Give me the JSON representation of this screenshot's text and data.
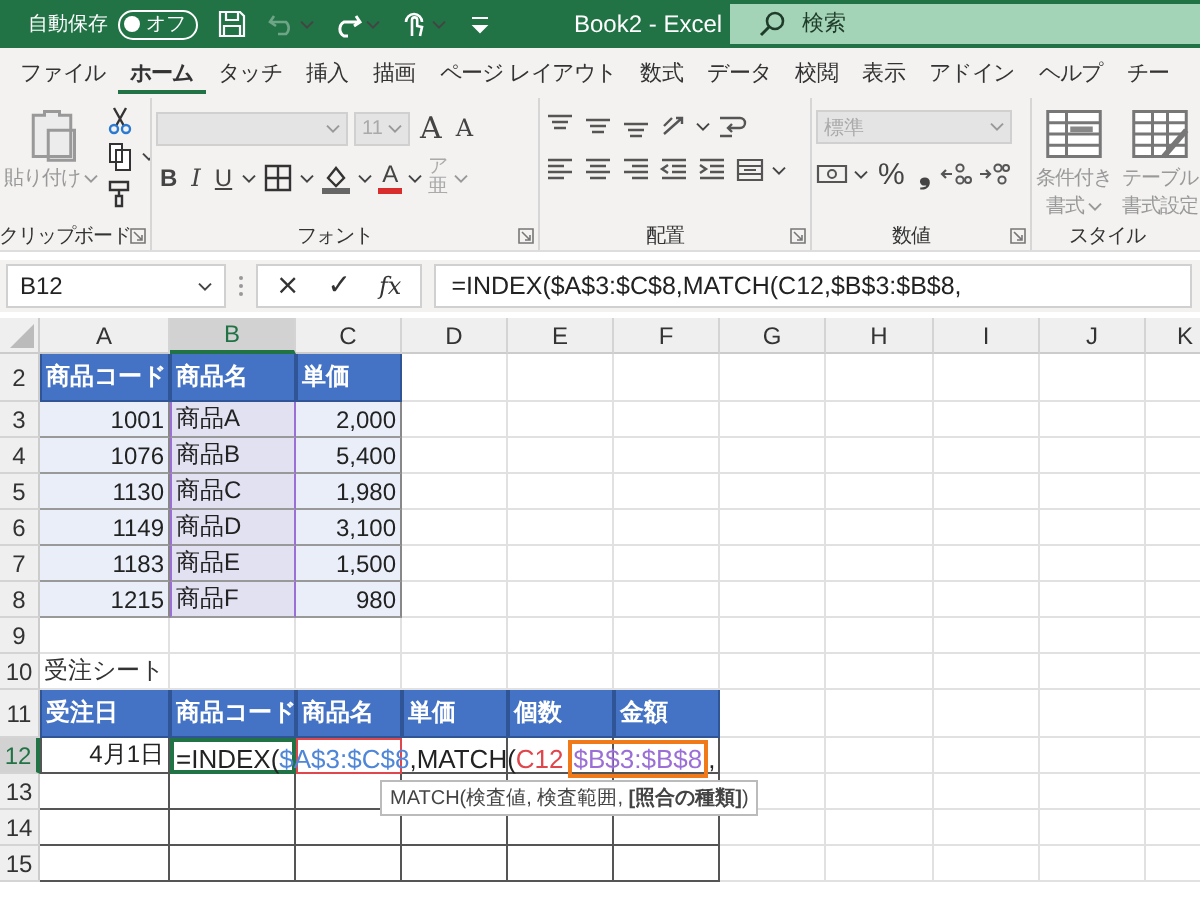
{
  "titlebar": {
    "autosave_label": "自動保存",
    "autosave": {
      "on": false,
      "label": "オフ"
    },
    "quick_access": [
      {
        "kind": "save",
        "disabled": false,
        "menu": false
      },
      {
        "kind": "undo",
        "disabled": true,
        "menu": true
      },
      {
        "kind": "redo",
        "disabled": false,
        "menu": true
      },
      {
        "kind": "touch",
        "disabled": false,
        "menu": true
      },
      {
        "kind": "customize",
        "disabled": false,
        "menu": false
      }
    ],
    "title": "Book2  -  Excel",
    "search": {
      "placeholder": "検索"
    }
  },
  "tabs": [
    {
      "label": "ファイル",
      "selected": false
    },
    {
      "label": "ホーム",
      "selected": true
    },
    {
      "label": "タッチ",
      "selected": false
    },
    {
      "label": "挿入",
      "selected": false
    },
    {
      "label": "描画",
      "selected": false
    },
    {
      "label": "ページ レイアウト",
      "selected": false
    },
    {
      "label": "数式",
      "selected": false
    },
    {
      "label": "データ",
      "selected": false
    },
    {
      "label": "校閲",
      "selected": false
    },
    {
      "label": "表示",
      "selected": false
    },
    {
      "label": "アドイン",
      "selected": false
    },
    {
      "label": "ヘルプ",
      "selected": false
    },
    {
      "label": "チー",
      "selected": false
    }
  ],
  "ribbon": [
    {
      "label": "クリップボード",
      "launcher": true,
      "large": [
        {
          "kind": "paste",
          "lines": [
            "貼り付け"
          ],
          "disabled": true,
          "menu": true
        }
      ],
      "rows": [
        {
          "items": [
            {
              "kind": "cut",
              "disabled": false,
              "menu": false
            }
          ]
        },
        {
          "items": [
            {
              "kind": "copy",
              "disabled": false,
              "menu": true
            }
          ]
        },
        {
          "items": [
            {
              "kind": "painter",
              "disabled": false,
              "menu": false
            }
          ]
        }
      ]
    },
    {
      "label": "フォント",
      "launcher": true,
      "rows": [
        {
          "items": [
            {
              "kind": "fontbox",
              "disabled": true,
              "menu": true
            },
            {
              "kind": "sizebox",
              "text": "11",
              "disabled": true,
              "menu": true
            },
            {
              "kind": "grow",
              "text": "A",
              "disabled": false,
              "menu": false
            },
            {
              "kind": "shrink",
              "text": "A",
              "disabled": false,
              "menu": false
            }
          ]
        },
        {
          "items": [
            {
              "kind": "bold",
              "text": "B",
              "disabled": false,
              "menu": false
            },
            {
              "kind": "italic",
              "text": "I",
              "disabled": false,
              "menu": false
            },
            {
              "kind": "underline",
              "text": "U",
              "disabled": false,
              "menu": true
            },
            {
              "kind": "borders",
              "disabled": false,
              "menu": true
            },
            {
              "kind": "fill",
              "disabled": false,
              "menu": true
            },
            {
              "kind": "fontcolor",
              "text": "A",
              "disabled": false,
              "menu": true
            },
            {
              "kind": "phonetic",
              "text": "ア亜",
              "disabled": true,
              "menu": true
            }
          ]
        }
      ]
    },
    {
      "label": "配置",
      "launcher": true,
      "rows": [
        {
          "items": [
            {
              "kind": "top",
              "disabled": false,
              "menu": false
            },
            {
              "kind": "middle",
              "disabled": false,
              "menu": false
            },
            {
              "kind": "bottom",
              "disabled": false,
              "menu": false
            },
            {
              "kind": "orient",
              "disabled": false,
              "menu": true
            },
            {
              "kind": "wrap",
              "disabled": false,
              "menu": false
            }
          ]
        },
        {
          "items": [
            {
              "kind": "left",
              "disabled": false,
              "menu": false
            },
            {
              "kind": "center",
              "disabled": false,
              "menu": false
            },
            {
              "kind": "right",
              "disabled": false,
              "menu": false
            },
            {
              "kind": "outdent",
              "disabled": false,
              "menu": false
            },
            {
              "kind": "indent",
              "disabled": false,
              "menu": false
            },
            {
              "kind": "merge",
              "disabled": false,
              "menu": true
            }
          ]
        }
      ]
    },
    {
      "label": "数値",
      "launcher": true,
      "rows": [
        {
          "items": [
            {
              "kind": "numbox",
              "text": "標準",
              "disabled": true,
              "menu": true
            }
          ]
        },
        {
          "items": [
            {
              "kind": "accounting",
              "disabled": false,
              "menu": true
            },
            {
              "kind": "percent",
              "text": "%",
              "disabled": false,
              "menu": false
            },
            {
              "kind": "comma",
              "text": "❟",
              "disabled": false,
              "menu": false
            },
            {
              "kind": "incdec",
              "disabled": false,
              "menu": false
            },
            {
              "kind": "decdec",
              "disabled": false,
              "menu": false
            }
          ]
        }
      ]
    },
    {
      "label": "スタイル",
      "launcher": false,
      "large": [
        {
          "kind": "cond",
          "lines": [
            "条件付き",
            "書式"
          ],
          "disabled": true,
          "menu": true
        },
        {
          "kind": "table",
          "lines": [
            "テーブル",
            "書式設定"
          ],
          "disabled": true,
          "menu": false
        }
      ]
    }
  ],
  "formula_bar": {
    "name_box": "B12",
    "cancel": "×",
    "enter": "✓",
    "function": "fx",
    "formula": "=INDEX($A$3:$C$8,MATCH(C12,$B$3:$B$8,"
  },
  "sheet": {
    "columns": [
      {
        "label": "A",
        "selected": false
      },
      {
        "label": "B",
        "selected": true
      },
      {
        "label": "C",
        "selected": false
      },
      {
        "label": "D",
        "selected": false
      },
      {
        "label": "E",
        "selected": false
      },
      {
        "label": "F",
        "selected": false
      },
      {
        "label": "G",
        "selected": false
      },
      {
        "label": "H",
        "selected": false
      },
      {
        "label": "I",
        "selected": false
      },
      {
        "label": "J",
        "selected": false
      },
      {
        "label": "K",
        "selected": false
      }
    ],
    "rows": [
      {
        "number": "2",
        "selected": false,
        "cells": [
          {
            "kind": "head",
            "text": "商品コード"
          },
          {
            "kind": "head",
            "text": "商品名"
          },
          {
            "kind": "head",
            "text": "単価"
          }
        ]
      },
      {
        "number": "3",
        "selected": false,
        "cells": [
          {
            "kind": "num",
            "text": "1001"
          },
          {
            "kind": "item",
            "text": "商品A"
          },
          {
            "kind": "num",
            "text": "2,000"
          }
        ]
      },
      {
        "number": "4",
        "selected": false,
        "cells": [
          {
            "kind": "num",
            "text": "1076"
          },
          {
            "kind": "item",
            "text": "商品B"
          },
          {
            "kind": "num",
            "text": "5,400"
          }
        ]
      },
      {
        "number": "5",
        "selected": false,
        "cells": [
          {
            "kind": "num",
            "text": "1130"
          },
          {
            "kind": "item",
            "text": "商品C"
          },
          {
            "kind": "num",
            "text": "1,980"
          }
        ]
      },
      {
        "number": "6",
        "selected": false,
        "cells": [
          {
            "kind": "num",
            "text": "1149"
          },
          {
            "kind": "item",
            "text": "商品D"
          },
          {
            "kind": "num",
            "text": "3,100"
          }
        ]
      },
      {
        "number": "7",
        "selected": false,
        "cells": [
          {
            "kind": "num",
            "text": "1183"
          },
          {
            "kind": "item",
            "text": "商品E"
          },
          {
            "kind": "num",
            "text": "1,500"
          }
        ]
      },
      {
        "number": "8",
        "selected": false,
        "cells": [
          {
            "kind": "num",
            "text": "1215"
          },
          {
            "kind": "item",
            "text": "商品F"
          },
          {
            "kind": "num",
            "text": "980"
          }
        ]
      },
      {
        "number": "9",
        "selected": false
      },
      {
        "number": "10",
        "selected": false,
        "cells": [
          {
            "kind": "note",
            "text": "受注シート"
          }
        ]
      },
      {
        "number": "11",
        "selected": false,
        "cells": [
          {
            "kind": "head",
            "text": "受注日"
          },
          {
            "kind": "head",
            "text": "商品コード"
          },
          {
            "kind": "head",
            "text": "商品名"
          },
          {
            "kind": "head",
            "text": "単価"
          },
          {
            "kind": "head",
            "text": "個数"
          },
          {
            "kind": "head",
            "text": "金額"
          }
        ]
      },
      {
        "number": "12",
        "selected": true,
        "cells": [
          {
            "kind": "date",
            "text": "4月1日"
          },
          {
            "kind": "active"
          },
          {
            "kind": "ref"
          },
          {
            "kind": "box"
          },
          {
            "kind": "box"
          },
          {
            "kind": "box"
          }
        ]
      },
      {
        "number": "13",
        "selected": false,
        "cells": [
          {
            "kind": "box"
          },
          {
            "kind": "box"
          },
          {
            "kind": "box"
          },
          {
            "kind": "box"
          },
          {
            "kind": "box"
          },
          {
            "kind": "box"
          }
        ]
      },
      {
        "number": "14",
        "selected": false,
        "cells": [
          {
            "kind": "box"
          },
          {
            "kind": "box"
          },
          {
            "kind": "box"
          },
          {
            "kind": "box"
          },
          {
            "kind": "box"
          },
          {
            "kind": "box"
          }
        ]
      },
      {
        "number": "15",
        "selected": false,
        "cells": [
          {
            "kind": "box"
          },
          {
            "kind": "box"
          },
          {
            "kind": "box"
          },
          {
            "kind": "box"
          },
          {
            "kind": "box"
          },
          {
            "kind": "box"
          }
        ]
      }
    ],
    "editor": {
      "segments": [
        {
          "text": "=INDEX(",
          "color": "#222222",
          "boxed": false
        },
        {
          "text": "$A$3:$C$8",
          "color": "#4f86d8",
          "boxed": false
        },
        {
          "text": ",MATCH(",
          "color": "#222222",
          "boxed": false
        },
        {
          "text": "C12",
          "color": "#e0474c",
          "boxed": false
        },
        {
          "text": "$B$3:$B$8",
          "color": "#9b6fd6",
          "boxed": true
        },
        {
          "text": ",",
          "color": "#222222",
          "boxed": false
        }
      ],
      "tooltip": "MATCH(検査値, 検査範囲, **[照合の種類]**)"
    }
  }
}
